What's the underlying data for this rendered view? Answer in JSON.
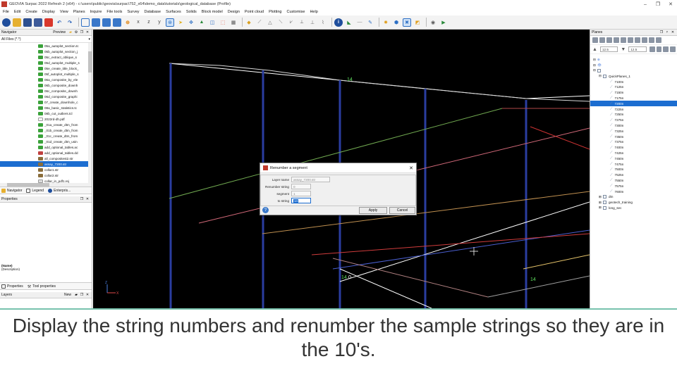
{
  "window": {
    "title": "GEOVIA Surpac 2022 Refresh 2 (x64) - c:\\users\\public\\geovia\\surpac\\752_x64\\demo_data\\tutorials\\geological_database (Profile)"
  },
  "menu": [
    "File",
    "Edit",
    "Create",
    "Display",
    "View",
    "Planes",
    "Inquire",
    "File tools",
    "Survey",
    "Database",
    "Surfaces",
    "Solids",
    "Block model",
    "Design",
    "Point cloud",
    "Plotting",
    "Customise",
    "Help"
  ],
  "navigator": {
    "title": "Navigator",
    "preview_label": "Preview",
    "filter": "All Files (*.*)",
    "files": [
      "05a_autoplot_section.tc",
      "05b_autoplot_section_j",
      "05c_extract_oblique_s",
      "05d_autoplot_multiple_s",
      "05e_create_title_block_",
      "05f_autoplot_multiple_s",
      "06a_composite_by_ele",
      "06b_composite_downh",
      "06c_composite_downh",
      "06d_composite_graphi",
      "07_create_downhole_c",
      "08a_basic_statistics.tc",
      "08b_cut_outliers.tcl",
      "2022rd-dh.pdf",
      "_01a_create_dtm_from",
      "_01b_create_dtm_from",
      "_01c_create_dtm_from",
      "_01d_create_dtm_usin",
      "add_optional_tables.ac",
      "add_optional_tables.dd",
      "all_compositest2.str",
      "assay_7200.str",
      "collar1.str",
      "collar2.str",
      "collar_in_pdf1.rej",
      "collar_in_pdf1.str"
    ],
    "selected": "assay_7200.str",
    "tabs": [
      "Navigator",
      "Legend",
      "Enterpris..."
    ]
  },
  "properties": {
    "title": "Properties",
    "name_label": "(Name)",
    "desc_label": "(Description)",
    "tabs": [
      "Properties",
      "Tool properties"
    ]
  },
  "layers": {
    "title": "Layers",
    "new_label": "New"
  },
  "planes": {
    "title": "Planes",
    "value1": "12.5",
    "value2": "12.5",
    "group": "QuickPlanes_1",
    "items": [
      "7100n",
      "7125n",
      "7150n",
      "7175n",
      "7200n",
      "7225n",
      "7250n",
      "7275n",
      "7300n",
      "7325n",
      "7350n",
      "7375n",
      "7400n",
      "7425n",
      "7450n",
      "7475n",
      "7500n",
      "7525n",
      "7550n",
      "7575n",
      "7600n"
    ],
    "selected": "7200n",
    "others": [
      "dtn",
      "geotech_training",
      "long_sec"
    ]
  },
  "viewport": {
    "labels": [
      "14",
      "14",
      "14",
      "0"
    ],
    "axis_x": "X",
    "axis_z": "Z"
  },
  "dialog": {
    "title": "Renumber a segment",
    "layer_name_label": "Layer name",
    "layer_name_value": "assay_7200.str",
    "renumber_string_label": "Renumber string",
    "renumber_string_value": "0",
    "segment_label": "segment",
    "segment_value": "1",
    "to_string_label": "to string",
    "to_string_value": "14",
    "apply_label": "Apply",
    "cancel_label": "Cancel"
  },
  "caption": "Display the string numbers and renumber the sample strings so they are in the 10's.",
  "colors": {
    "selection": "#1c6dd0",
    "accent": "#78c2ad",
    "file_icon": "#3aa23a"
  }
}
